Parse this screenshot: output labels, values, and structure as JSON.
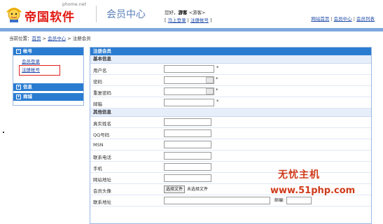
{
  "header": {
    "domain": "phome.net",
    "brand": "帝国软件",
    "title": "会员中心",
    "welcome_prefix": "您好，",
    "welcome_user": "游客",
    "welcome_suffix": "<游客>",
    "login_link": "马上登录",
    "register_link": "注册帐号",
    "top_links": [
      "网站首页",
      "会员中心",
      "会员列表"
    ]
  },
  "breadcrumb": {
    "prefix": "当前位置：",
    "items": [
      "首页",
      "会员中心",
      "注册会员"
    ]
  },
  "sidebar": {
    "sections": [
      {
        "title": "帐号",
        "items": [
          "会员登录",
          "注册帐号"
        ]
      },
      {
        "title": "信息",
        "items": []
      },
      {
        "title": "商城",
        "items": []
      }
    ]
  },
  "form": {
    "title": "注册会员",
    "basic_title": "基本信息",
    "basic_fields": [
      {
        "label": "用户名",
        "required": "*"
      },
      {
        "label": "密码",
        "required": "*"
      },
      {
        "label": "重复密码",
        "required": "*"
      },
      {
        "label": "邮箱",
        "required": "*"
      }
    ],
    "other_title": "其他信息",
    "other_fields": [
      {
        "label": "真实姓名"
      },
      {
        "label": "QQ号码"
      },
      {
        "label": "MSN"
      },
      {
        "label": "联系电话"
      },
      {
        "label": "手机"
      },
      {
        "label": "网站地址"
      },
      {
        "label": "会员头像"
      },
      {
        "label": "联系地址"
      }
    ],
    "file_button": "选择文件",
    "file_status": "未选择文件",
    "zip_label": "邮编:"
  },
  "watermark": {
    "line1": "无忧主机",
    "line2": "www.51php.com"
  },
  "colors": {
    "accent_blue": "#2a7cd1",
    "header_bar": "#7ea8dc",
    "brand_red": "#e11a14",
    "highlight_red": "#e02020"
  }
}
